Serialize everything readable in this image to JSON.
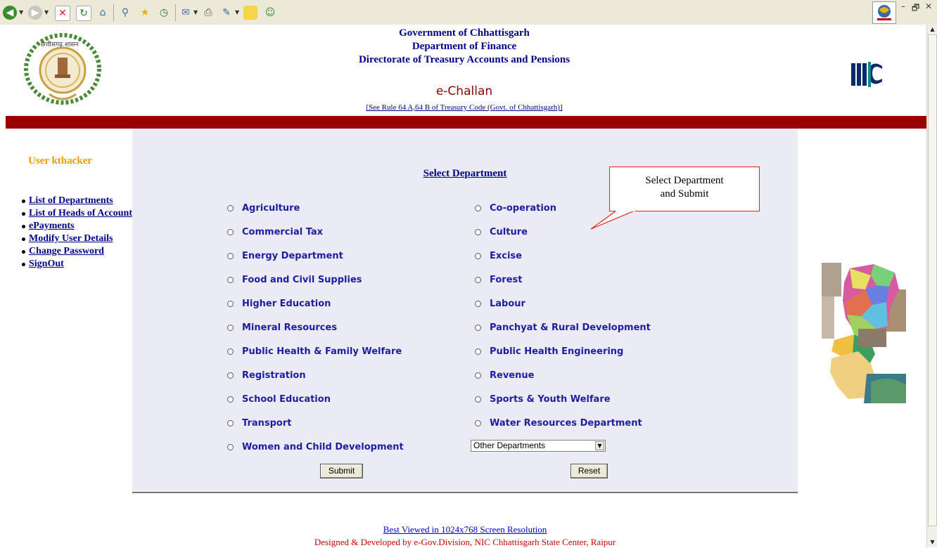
{
  "browser": {
    "toolbar_icons": [
      "back-icon",
      "forward-icon",
      "stop-icon",
      "refresh-icon",
      "home-icon",
      "search-icon",
      "favorites-icon",
      "history-icon",
      "mail-icon",
      "print-icon",
      "edit-icon",
      "notes-icon",
      "messenger-icon"
    ],
    "window_controls": [
      "–",
      "🗗",
      "✕"
    ]
  },
  "header": {
    "line1": "Government of Chhattisgarh",
    "line2": "Department of Finance",
    "line3": "Directorate of Treasury Accounts and Pensions",
    "app_title": "e-Challan",
    "rule_link": "[See Rule 64 A,64 B of Treasury Code (Govt. of Chhattisgarh)]",
    "emblem_text": "छत्तीसगढ़ शासन",
    "nic_logo": "NIC"
  },
  "sidebar": {
    "user": "User kthacker",
    "links": [
      "List of Departments",
      "List of Heads of Account",
      "ePayments",
      "Modify User Details",
      "Change Password",
      "SignOut"
    ]
  },
  "main": {
    "title": "Select Department",
    "departments_left": [
      "Agriculture",
      "Commercial Tax",
      "Energy Department",
      "Food and Civil Supplies",
      "Higher Education",
      "Mineral Resources",
      "Public Health & Family Welfare",
      "Registration",
      "School Education",
      "Transport",
      "Women and Child Development"
    ],
    "departments_right": [
      "Co-operation",
      "Culture",
      "Excise",
      "Forest",
      "Labour",
      "Panchyat & Rural Development",
      "Public Health Engineering",
      "Revenue",
      "Sports & Youth Welfare",
      "Water Resources Department"
    ],
    "other_select": "Other Departments",
    "submit_label": "Submit",
    "reset_label": "Reset"
  },
  "callout": {
    "line1": "Select Department",
    "line2": "and Submit"
  },
  "footer": {
    "resolution": "Best Viewed in 1024x768 Screen Resolution",
    "credit": "Designed & Developed by e-Gov.Division, NIC Chhattisgarh State Center, Raipur"
  },
  "colors": {
    "red_bar": "#990000",
    "panel_bg": "#ebebf6",
    "link_blue": "#00008b",
    "user_orange": "#e8a000"
  }
}
